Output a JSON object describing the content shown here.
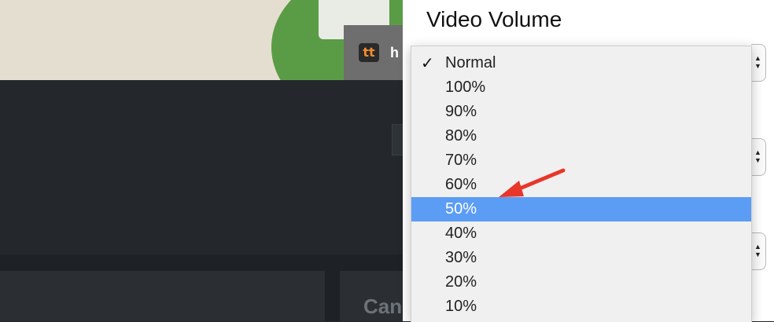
{
  "background": {
    "logo_text": "tt",
    "logo_trailing_text": "h",
    "card_partial_text": "Can"
  },
  "settings": {
    "title": "Video Volume",
    "volume_select": {
      "selected": "Normal",
      "options": [
        "Normal",
        "100%",
        "90%",
        "80%",
        "70%",
        "60%",
        "50%",
        "40%",
        "30%",
        "20%",
        "10%"
      ],
      "highlighted": "50%"
    }
  },
  "annotation": {
    "arrow_color": "#e8362a",
    "target": "50%"
  },
  "colors": {
    "highlight": "#5b9cf5",
    "dropdown_bg": "#f0f0f0"
  },
  "icons": {
    "checkmark": "checkmark-icon",
    "select_arrows": "up-down-arrows-icon"
  }
}
